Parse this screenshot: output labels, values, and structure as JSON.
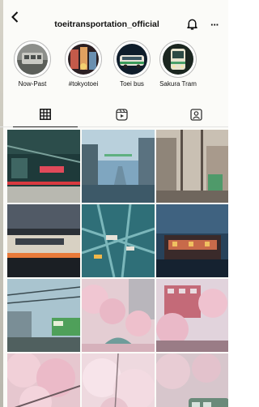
{
  "header": {
    "username": "toeitransportation_official",
    "back_icon": "chevron-left-icon",
    "bell_icon": "bell-icon",
    "more_label": "···"
  },
  "highlights": [
    {
      "label": "Now-Past"
    },
    {
      "label": "#tokyotoei"
    },
    {
      "label": "Toei bus"
    },
    {
      "label": "Sakura Tram"
    }
  ],
  "tabs": [
    {
      "name": "grid-icon",
      "active": true
    },
    {
      "name": "reels-icon",
      "active": false
    },
    {
      "name": "tagged-icon",
      "active": false
    }
  ],
  "posts": [
    {
      "subject": "train interior"
    },
    {
      "subject": "city street"
    },
    {
      "subject": "tram street"
    },
    {
      "subject": "station platform"
    },
    {
      "subject": "intersection"
    },
    {
      "subject": "evening shrine"
    },
    {
      "subject": "green train"
    },
    {
      "subject": "river with sakura"
    },
    {
      "subject": "sakura building"
    },
    {
      "subject": "sakura"
    },
    {
      "subject": "sakura"
    },
    {
      "subject": "tram under sakura"
    }
  ]
}
